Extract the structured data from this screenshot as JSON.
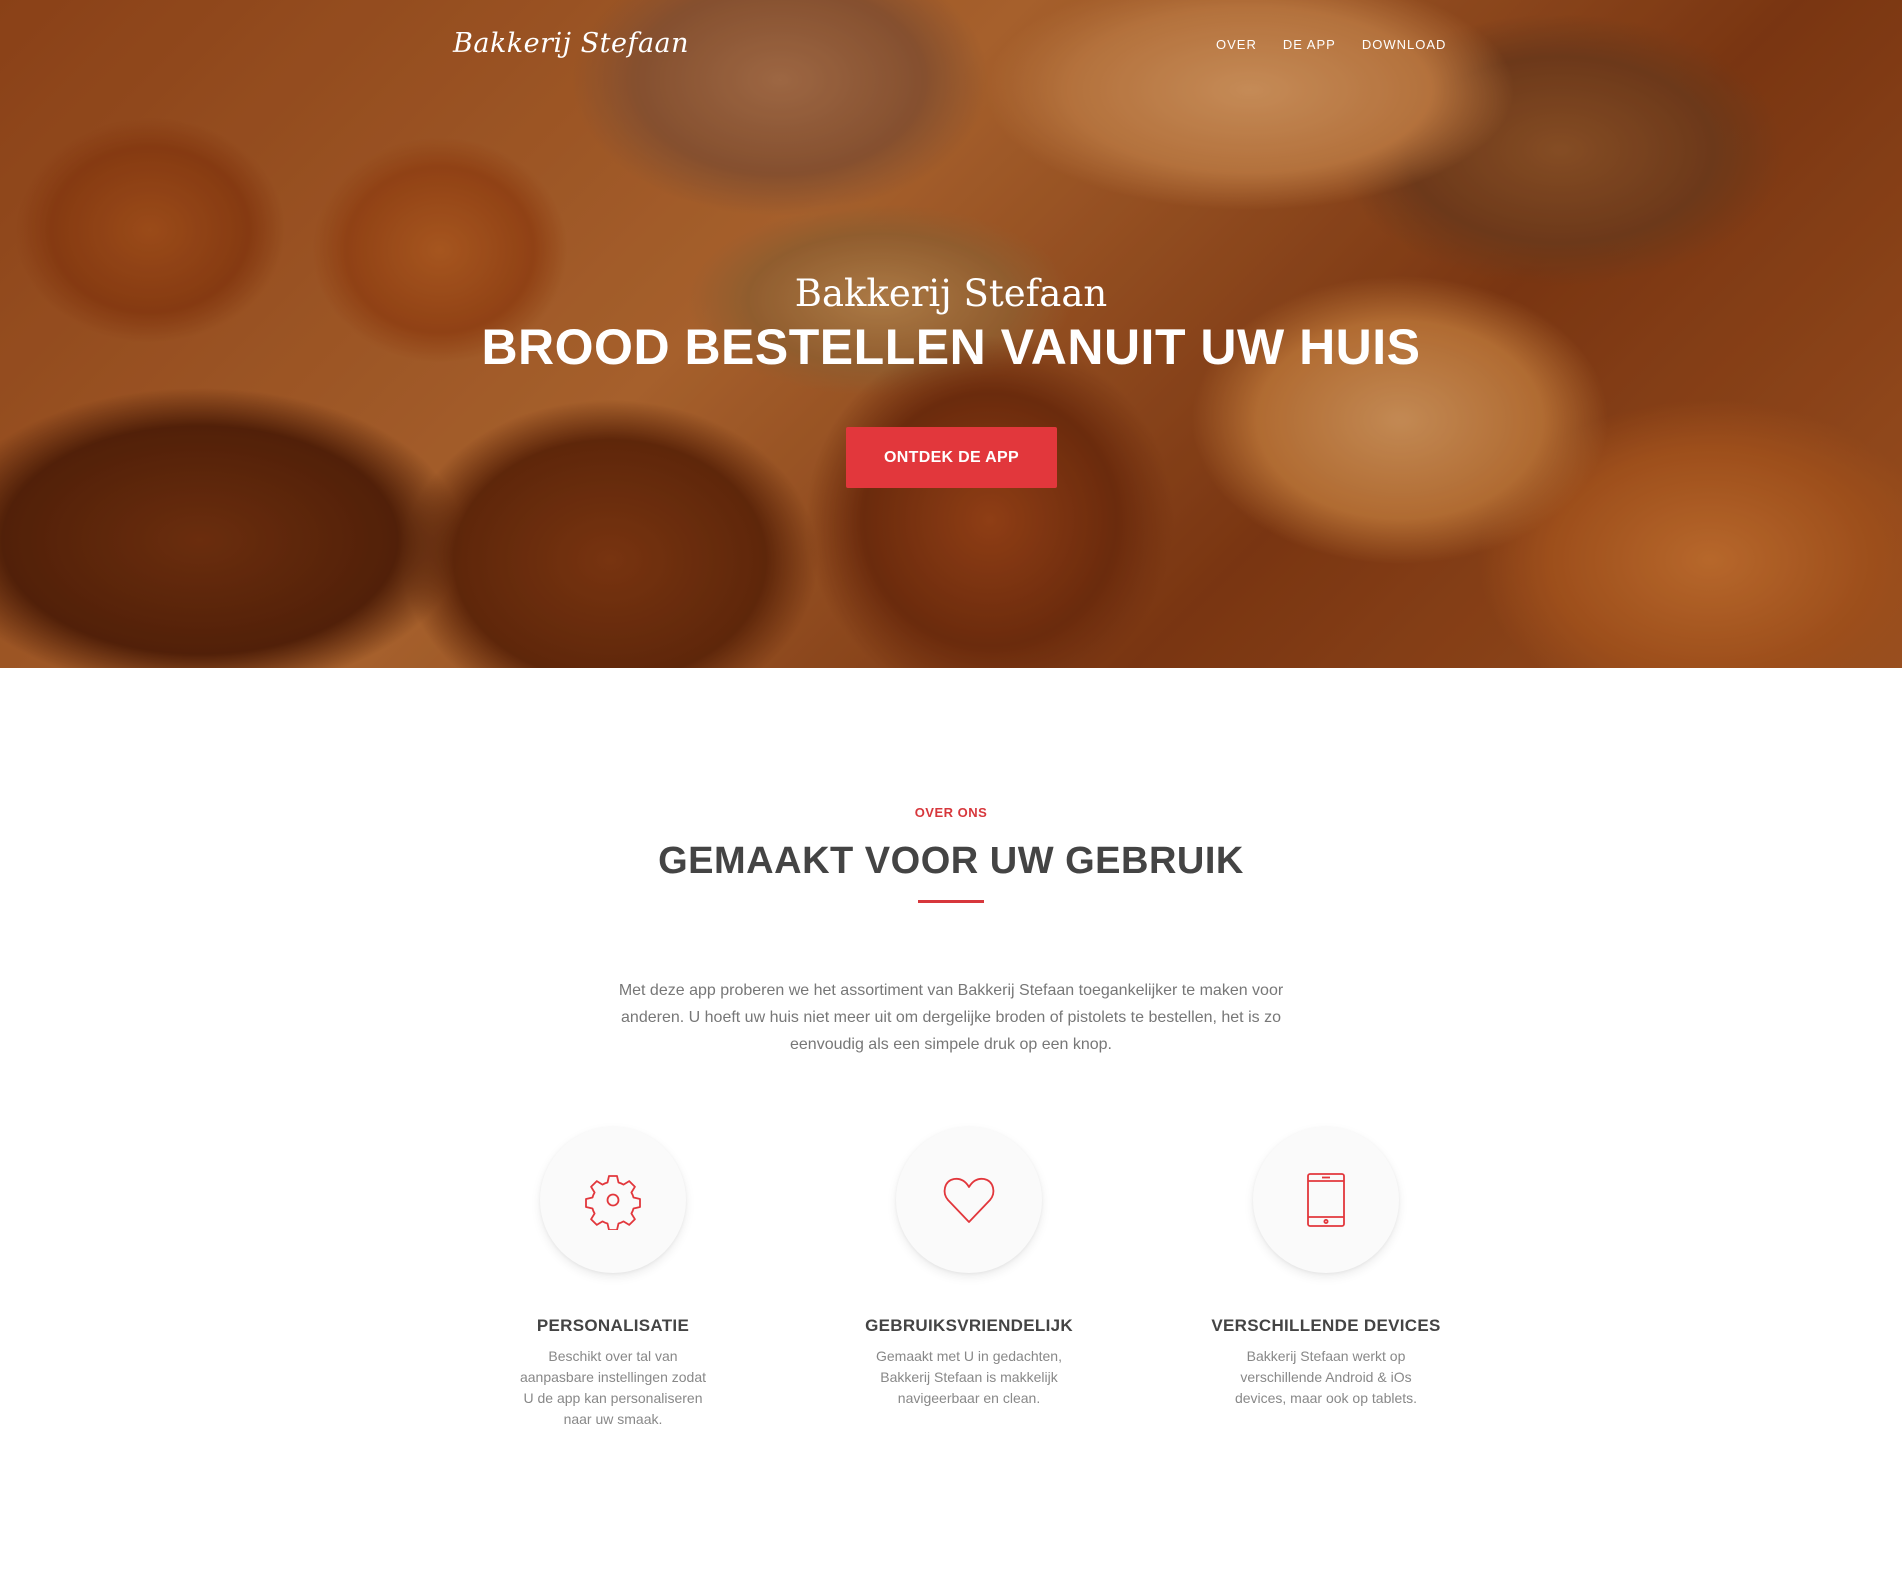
{
  "colors": {
    "accent": "#e2373c",
    "heading": "#444444",
    "body_text": "#777777"
  },
  "header": {
    "brand": "Bakkerij Stefaan",
    "nav": [
      "OVER",
      "DE APP",
      "DOWNLOAD"
    ]
  },
  "hero": {
    "subtitle": "Bakkerij Stefaan",
    "title": "BROOD BESTELLEN VANUIT UW HUIS",
    "cta_label": "ONTDEK DE APP"
  },
  "about": {
    "eyebrow": "OVER ONS",
    "title_bold": "GEMAAKT",
    "title_rest": " VOOR UW GEBRUIK",
    "intro": "Met deze app proberen we het assortiment van Bakkerij Stefaan toegankelijker te maken voor anderen. U hoeft uw huis niet meer uit om dergelijke broden of pistolets te bestellen, het is zo eenvoudig als een simpele druk op een knop."
  },
  "features": [
    {
      "icon": "gear-icon",
      "title": "PERSONALISATIE",
      "text": "Beschikt over tal van aanpasbare instellingen zodat U de app kan personaliseren naar uw smaak."
    },
    {
      "icon": "heart-icon",
      "title": "GEBRUIKSVRIENDELIJK",
      "text": "Gemaakt met U in gedachten, Bakkerij Stefaan is makkelijk navigeerbaar en clean."
    },
    {
      "icon": "tablet-icon",
      "title": "VERSCHILLENDE DEVICES",
      "text": "Bakkerij Stefaan werkt op verschillende Android & iOs devices, maar ook op tablets."
    }
  ]
}
